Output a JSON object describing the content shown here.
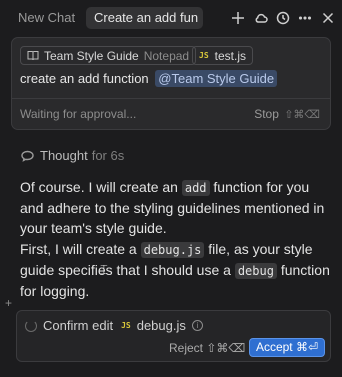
{
  "tabs": {
    "new_chat": "New Chat",
    "active": "Create an add fun"
  },
  "toolbar_icons": [
    "plus-icon",
    "cloud-icon",
    "history-icon",
    "more-icon",
    "close-icon"
  ],
  "composer": {
    "context_chips": [
      {
        "label": "Team Style Guide",
        "sub": "Notepad",
        "icon": "book-icon"
      },
      {
        "label": "test.js",
        "icon": "js-file-icon"
      }
    ],
    "prompt_text": "create an add function",
    "mention": "@Team Style Guide",
    "status": "Waiting for approval...",
    "stop_label": "Stop",
    "stop_shortcut": "⇧⌘⌫"
  },
  "thought": {
    "label": "Thought",
    "duration": "for 6s"
  },
  "message": {
    "p1_a": "Of course. I will create an ",
    "p1_code": "add",
    "p1_b": " function for you and adhere to the styling guidelines mentioned in your team's style guide.",
    "p2_a": "First, I will create a ",
    "p2_code1": "debug.js",
    "p2_b": " file, as your style guide specifies that I should use a ",
    "p2_code2": "debug",
    "p2_c": " function for logging."
  },
  "confirm": {
    "label": "Confirm edit",
    "file": "debug.js",
    "reject_label": "Reject ⇧⌘⌫",
    "accept_label": "Accept ⌘⏎"
  },
  "colors": {
    "background": "#1c1c1e",
    "accent": "#2f6fd1",
    "mention": "#3a4a66",
    "js_badge": "#d8c73a"
  }
}
